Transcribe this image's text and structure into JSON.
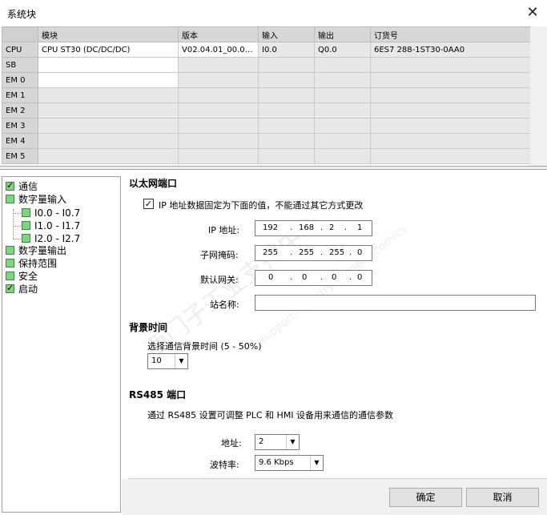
{
  "window": {
    "title": "系统块",
    "close_glyph": "✕"
  },
  "module_table": {
    "headers": [
      "模块",
      "版本",
      "输入",
      "输出",
      "订货号"
    ],
    "rows": [
      {
        "slot": "CPU",
        "module": "CPU ST30 (DC/DC/DC)",
        "version": "V02.04.01_00.00...",
        "input": "I0.0",
        "output": "Q0.0",
        "order": "6ES7 288-1ST30-0AA0"
      },
      {
        "slot": "SB",
        "module": "",
        "version": "",
        "input": "",
        "output": "",
        "order": ""
      },
      {
        "slot": "EM 0",
        "module": "",
        "version": "",
        "input": "",
        "output": "",
        "order": ""
      },
      {
        "slot": "EM 1",
        "module": "",
        "version": "",
        "input": "",
        "output": "",
        "order": ""
      },
      {
        "slot": "EM 2",
        "module": "",
        "version": "",
        "input": "",
        "output": "",
        "order": ""
      },
      {
        "slot": "EM 3",
        "module": "",
        "version": "",
        "input": "",
        "output": "",
        "order": ""
      },
      {
        "slot": "EM 4",
        "module": "",
        "version": "",
        "input": "",
        "output": "",
        "order": ""
      },
      {
        "slot": "EM 5",
        "module": "",
        "version": "",
        "input": "",
        "output": "",
        "order": ""
      }
    ]
  },
  "tree": {
    "items": [
      {
        "label": "通信",
        "checked": true
      },
      {
        "label": "数字量输入",
        "checked": false
      },
      {
        "label": "I0.0 - I0.7",
        "checked": false
      },
      {
        "label": "I1.0 - I1.7",
        "checked": false
      },
      {
        "label": "I2.0 - I2.7",
        "checked": false
      },
      {
        "label": "数字量输出",
        "checked": false
      },
      {
        "label": "保持范围",
        "checked": false
      },
      {
        "label": "安全",
        "checked": false
      },
      {
        "label": "启动",
        "checked": true
      }
    ]
  },
  "ethernet": {
    "title": "以太网端口",
    "fixed_ip_label": "IP 地址数据固定为下面的值，不能通过其它方式更改",
    "fixed_ip_checked": true,
    "ip_label": "IP 地址:",
    "ip": [
      "192",
      "168",
      "2",
      "1"
    ],
    "mask_label": "子网掩码:",
    "mask": [
      "255",
      "255",
      "255",
      "0"
    ],
    "gateway_label": "默认网关:",
    "gateway": [
      "0",
      "0",
      "0",
      "0"
    ],
    "station_label": "站名称:",
    "station_value": "",
    "dot": "."
  },
  "background": {
    "title": "背景时间",
    "select_label": "选择通信背景时间 (5 - 50%)",
    "value": "10"
  },
  "rs485": {
    "title": "RS485 端口",
    "desc": "通过 RS485 设置可调整 PLC 和 HMI 设备用来通信的通信参数",
    "address_label": "地址:",
    "address_value": "2",
    "baud_label": "波特率:",
    "baud_value": "9.6 Kbps"
  },
  "buttons": {
    "ok": "确定",
    "cancel": "取消"
  },
  "watermark": {
    "text1": "西门子工业支持中心",
    "text2": "support.industry.siemens.com/cs"
  },
  "colors": {
    "tree_box": "#7dd67d",
    "header_gray": "#d7d7d7",
    "cell_gray": "#e8e8e8"
  }
}
